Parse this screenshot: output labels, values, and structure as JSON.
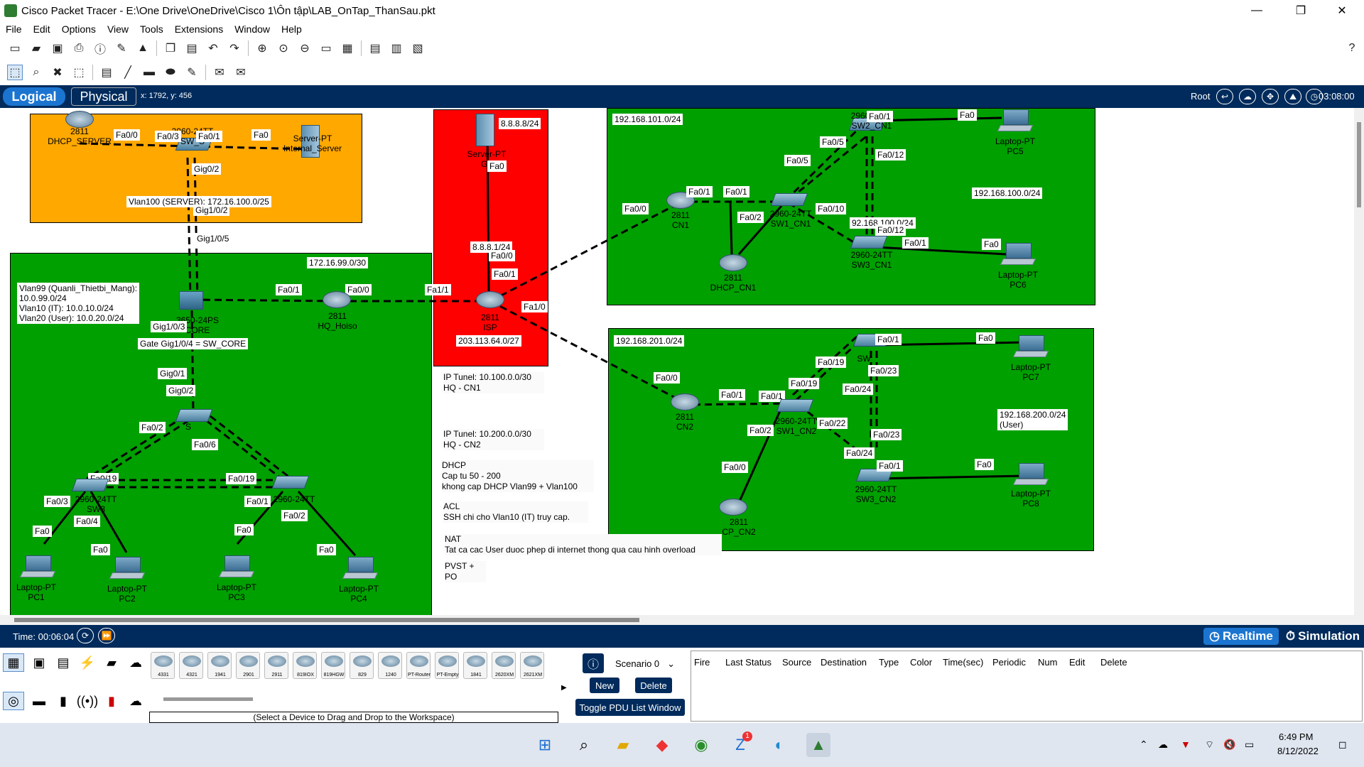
{
  "window": {
    "title": "Cisco Packet Tracer - E:\\One Drive\\OneDrive\\Cisco 1\\Ôn tập\\LAB_OnTap_ThanSau.pkt",
    "minimize": "—",
    "maximize": "❐",
    "close": "✕"
  },
  "menu": [
    "File",
    "Edit",
    "Options",
    "View",
    "Tools",
    "Extensions",
    "Window",
    "Help"
  ],
  "help_icon": "?",
  "modebar": {
    "logical": "Logical",
    "physical": "Physical",
    "coords": "x: 1792, y: 456",
    "root": "Root",
    "clock": "03:08:00"
  },
  "areas": {
    "server": {
      "color": "#ffa800",
      "subnet": "Vlan100 (SERVER): 172.16.100.0/25"
    },
    "hq": {
      "color": "#00a000",
      "subnet": "172.16.99.0/30",
      "vlans": [
        "Vlan99 (Quanli_Thietbi_Mang):",
        "10.0.99.0/24",
        "Vlan10 (IT): 10.0.10.0/24",
        "Vlan20 (User): 10.0.20.0/24"
      ],
      "gateway": "Gate",
      "gateway_tail": "= SW_CORE"
    },
    "isp": {
      "color": "#ff0000",
      "google_net": "8.8.8.8/24",
      "isp_net": "203.113.64.0/27",
      "link": "8.8.8.1/24"
    },
    "cn1": {
      "lan1": "192.168.101.0/24",
      "lan2": "192.168.100.0/24",
      "link": "92.168.100.0/24"
    },
    "cn2": {
      "lan1": "192.168.201.0/24",
      "lan2": "192.168.200.0/24",
      "lan2_sub": "(User)"
    }
  },
  "devices": {
    "dhcp_server": [
      "2811",
      "DHCP_SERVER"
    ],
    "sw_server": [
      "2960-24TT",
      "SW_S"
    ],
    "internal_server": [
      "Server-PT",
      "Internal_Server"
    ],
    "google": [
      "Server-PT",
      "Go"
    ],
    "isp": [
      "2811",
      "ISP"
    ],
    "hq_hoiso": [
      "2811",
      "HQ_Hoiso"
    ],
    "sw_core": [
      "3650-24PS",
      "CORE"
    ],
    "sw_dist": [
      "2960-24TT",
      "S"
    ],
    "sw_acc1": [
      "2960-24TT",
      "SW3"
    ],
    "sw_acc2": [
      "2960-24TT",
      ""
    ],
    "pc1": [
      "Laptop-PT",
      "PC1"
    ],
    "pc2": [
      "Laptop-PT",
      "PC2"
    ],
    "pc3": [
      "Laptop-PT",
      "PC3"
    ],
    "pc4": [
      "Laptop-PT",
      "PC4"
    ],
    "cn1": [
      "2811",
      "CN1"
    ],
    "dhcp_cn1": [
      "2811",
      "DHCP_CN1"
    ],
    "sw1_cn1": [
      "2960-24TT",
      "SW1_CN1"
    ],
    "sw2_cn1": [
      "2960-24TT",
      "SW2_CN1"
    ],
    "sw3_cn1": [
      "2960-24TT",
      "SW3_CN1"
    ],
    "pc5": [
      "Laptop-PT",
      "PC5"
    ],
    "pc6": [
      "Laptop-PT",
      "PC6"
    ],
    "cn2": [
      "2811",
      "CN2"
    ],
    "dhcp_cn2": [
      "2811",
      "CP_CN2"
    ],
    "sw1_cn2": [
      "2960-24TT",
      "SW1_CN2"
    ],
    "sw2_cn2": [
      "2960-24TT",
      "SW"
    ],
    "sw3_cn2": [
      "2960-24TT",
      "SW3_CN2"
    ],
    "pc7": [
      "Laptop-PT",
      "PC7"
    ],
    "pc8": [
      "Laptop-PT",
      "PC8"
    ]
  },
  "ports": [
    "Fa0/0",
    "Fa0/3",
    "Fa0/1",
    "Fa0",
    "Gig0/2",
    "Gig1/0/2",
    "Gig1/0/5",
    "Fa0/1",
    "Fa0/0",
    "Fa1/1",
    "Fa1/0",
    "Gig1/0/3",
    "Gig1/0/4",
    "Gig0/1",
    "Gig0/2",
    "Fa0/2",
    "Fa0/6",
    "Fa0/19",
    "Fa0/19",
    "Fa0/3",
    "Fa0/4",
    "Fa0",
    "Fa0",
    "Fa0/1",
    "Fa0/2",
    "Fa0",
    "Fa0",
    "Fa0",
    "Fa0/0",
    "Fa0/1",
    "Fa0/1",
    "Fa0/5",
    "Fa0/10",
    "Fa0/12",
    "Fa0/12",
    "Fa0/1",
    "Fa0",
    "Fa0",
    "Fa0/2",
    "Fa0/0",
    "Fa0/1",
    "Fa0/1",
    "Fa0/19",
    "Fa0/19",
    "Fa0/23",
    "Fa0/24",
    "Fa0/22",
    "Fa0/23",
    "Fa0/24",
    "Fa0/1",
    "Fa0",
    "Fa0",
    "Fa0/2",
    "Fa0/0",
    "Fa0"
  ],
  "notes": {
    "tunnel1": [
      "IP Tunel: 10.100.0.0/30",
      "HQ - CN1"
    ],
    "tunnel2": [
      "IP Tunel: 10.200.0.0/30",
      "HQ - CN2"
    ],
    "dhcp": [
      "DHCP",
      "Cap tu 50 - 200",
      "khong cap DHCP Vlan99 + Vlan100"
    ],
    "acl": [
      "ACL",
      "SSH chi cho Vlan10 (IT) truy cap."
    ],
    "nat": [
      "NAT",
      "Tat ca cac User duoc phep di internet thong qua cau hinh overload"
    ],
    "pvst": [
      "PVST +",
      "PO"
    ]
  },
  "bottombar": {
    "time": "Time: 00:06:04",
    "realtime": "Realtime",
    "simulation": "Simulation"
  },
  "device_models": [
    "4331",
    "4321",
    "1941",
    "2901",
    "2911",
    "819IOX",
    "819HGW",
    "829",
    "1240",
    "PT-Router",
    "PT-Empty",
    "1841",
    "2620XM",
    "2621XM"
  ],
  "device_hint": "(Select a Device to Drag and Drop to the Workspace)",
  "pdu": {
    "scenario": "Scenario 0",
    "new": "New",
    "delete": "Delete",
    "toggle": "Toggle PDU List Window",
    "columns": [
      "Fire",
      "Last Status",
      "Source",
      "Destination",
      "Type",
      "Color",
      "Time(sec)",
      "Periodic",
      "Num",
      "Edit",
      "Delete"
    ]
  },
  "taskbar": {
    "time": "6:49 PM",
    "date": "8/12/2022",
    "zalo_badge": "1"
  }
}
